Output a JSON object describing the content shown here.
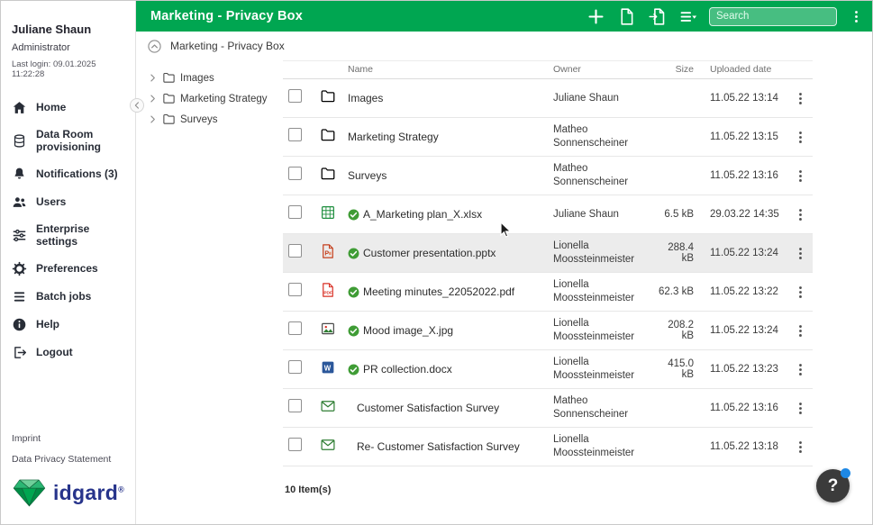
{
  "topbar": {
    "title": "Marketing - Privacy Box",
    "actions": [
      {
        "icon": "plus-icon"
      },
      {
        "icon": "new-document-icon"
      },
      {
        "icon": "import-document-icon"
      },
      {
        "icon": "view-options-icon"
      }
    ],
    "search": {
      "placeholder": "Search"
    },
    "menu_icon": "kebab-icon"
  },
  "breadcrumb": {
    "collapse_icon": "circle-chevron-up-icon",
    "label": "Marketing - Privacy Box"
  },
  "sidebar": {
    "user": {
      "name": "Juliane Shaun",
      "role": "Administrator",
      "last_login": "Last login: 09.01.2025 11:22:28"
    },
    "items": [
      {
        "icon": "home-icon",
        "label": "Home"
      },
      {
        "icon": "data-room-icon",
        "label": "Data Room provisioning"
      },
      {
        "icon": "bell-icon",
        "label": "Notifications (3)"
      },
      {
        "icon": "users-icon",
        "label": "Users"
      },
      {
        "icon": "sliders-icon",
        "label": "Enterprise settings"
      },
      {
        "icon": "gear-icon",
        "label": "Preferences"
      },
      {
        "icon": "list-icon",
        "label": "Batch jobs"
      },
      {
        "icon": "info-icon",
        "label": "Help"
      },
      {
        "icon": "logout-icon",
        "label": "Logout"
      }
    ],
    "footer_links": [
      {
        "label": "Imprint"
      },
      {
        "label": "Data Privacy Statement"
      }
    ],
    "logo": {
      "text": "idgard",
      "registered": "®",
      "gem_icon": "idgard-gem-icon"
    }
  },
  "tree": {
    "items": [
      {
        "icon": "folder-icon",
        "label": "Images"
      },
      {
        "icon": "folder-icon",
        "label": "Marketing Strategy"
      },
      {
        "icon": "folder-icon",
        "label": "Surveys"
      }
    ]
  },
  "files": {
    "columns": {
      "name": "Name",
      "owner": "Owner",
      "size": "Size",
      "uploaded": "Uploaded date"
    },
    "rows": [
      {
        "icon": "folder-icon",
        "name": "Images",
        "owner": "Juliane Shaun",
        "size": "",
        "uploaded": "11.05.22 13:14",
        "verified": false,
        "selected": false
      },
      {
        "icon": "folder-icon",
        "name": "Marketing Strategy",
        "owner": "Matheo Sonnenscheiner",
        "size": "",
        "uploaded": "11.05.22 13:15",
        "verified": false,
        "selected": false
      },
      {
        "icon": "folder-icon",
        "name": "Surveys",
        "owner": "Matheo Sonnenscheiner",
        "size": "",
        "uploaded": "11.05.22 13:16",
        "verified": false,
        "selected": false
      },
      {
        "icon": "xlsx-icon",
        "name": "A_Marketing plan_X.xlsx",
        "owner": "Juliane Shaun",
        "size": "6.5 kB",
        "uploaded": "29.03.22 14:35",
        "verified": true,
        "selected": false
      },
      {
        "icon": "pptx-icon",
        "name": "Customer presentation.pptx",
        "owner": "Lionella Moossteinmeister",
        "size": "288.4 kB",
        "uploaded": "11.05.22 13:24",
        "verified": true,
        "selected": true
      },
      {
        "icon": "pdf-icon",
        "name": "Meeting minutes_22052022.pdf",
        "owner": "Lionella Moossteinmeister",
        "size": "62.3 kB",
        "uploaded": "11.05.22 13:22",
        "verified": true,
        "selected": false
      },
      {
        "icon": "image-icon",
        "name": "Mood image_X.jpg",
        "owner": "Lionella Moossteinmeister",
        "size": "208.2 kB",
        "uploaded": "11.05.22 13:24",
        "verified": true,
        "selected": false
      },
      {
        "icon": "docx-icon",
        "name": "PR collection.docx",
        "owner": "Lionella Moossteinmeister",
        "size": "415.0 kB",
        "uploaded": "11.05.22 13:23",
        "verified": true,
        "selected": false
      },
      {
        "icon": "message-icon",
        "name": "Customer Satisfaction Survey",
        "owner": "Matheo Sonnenscheiner",
        "size": "",
        "uploaded": "11.05.22 13:16",
        "verified": false,
        "selected": false
      },
      {
        "icon": "message-icon",
        "name": "Re- Customer Satisfaction Survey",
        "owner": "Lionella Moossteinmeister",
        "size": "",
        "uploaded": "11.05.22 13:18",
        "verified": false,
        "selected": false
      }
    ],
    "count": "10 Item(s)"
  },
  "help": {
    "label": "?"
  },
  "colors": {
    "accent_green": "#00a651",
    "dark_navy": "#282d37",
    "logo_blue": "#27348b",
    "verified_green": "#3f9c35",
    "selected_row": "#ececec"
  }
}
